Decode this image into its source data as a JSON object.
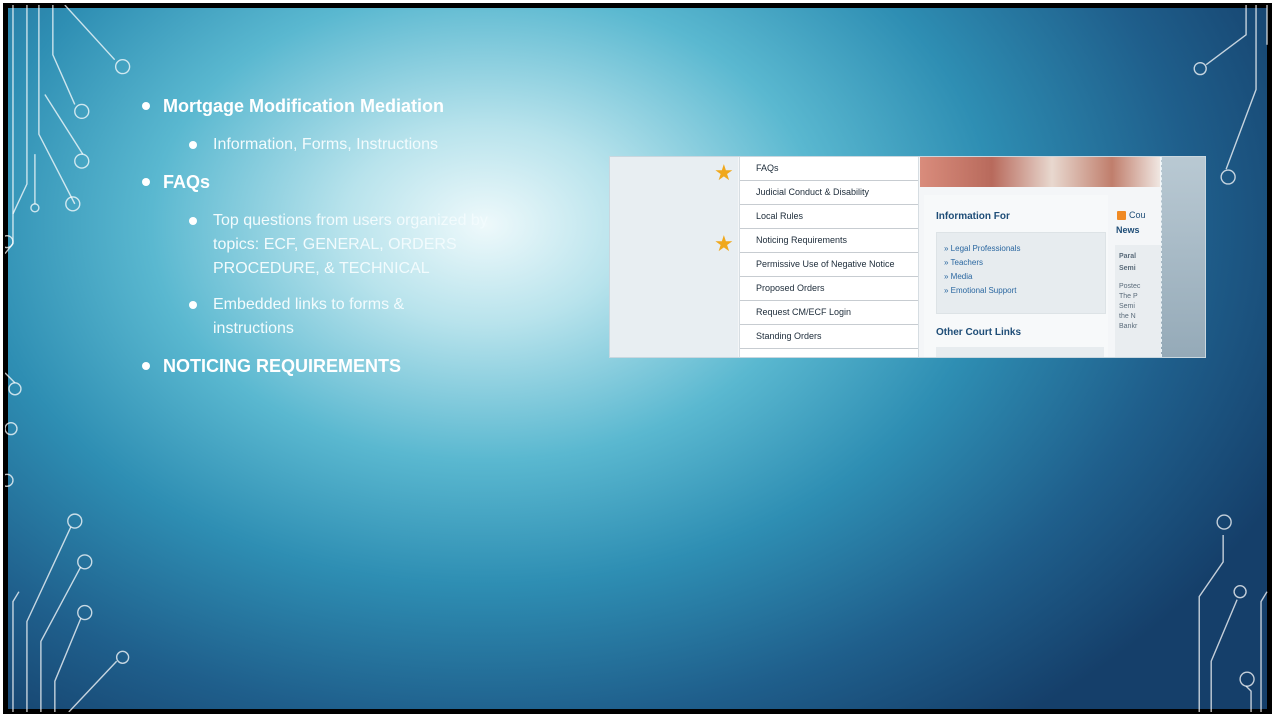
{
  "slide": {
    "bullets": [
      {
        "label": "Mortgage Modification Mediation",
        "sub": [
          "Information, Forms, Instructions"
        ]
      },
      {
        "label": "FAQs",
        "sub": [
          "Top questions from users organized by topics:  ECF, GENERAL, ORDERS PROCEDURE, & TECHNICAL",
          "Embedded links to forms & instructions"
        ]
      },
      {
        "label": "NOTICING REQUIREMENTS",
        "sub": []
      }
    ]
  },
  "screenshot": {
    "menu_items": [
      "FAQs",
      "Judicial Conduct & Disability",
      "Local Rules",
      "Noticing Requirements",
      "Permissive Use of Negative Notice",
      "Proposed Orders",
      "Request CM/ECF Login",
      "Standing Orders"
    ],
    "starred_items": [
      "FAQs",
      "Noticing Requirements"
    ],
    "star_color": "#f0a81c",
    "info_title": "Information For",
    "info_links": [
      "» Legal Professionals",
      "» Teachers",
      "» Media",
      "» Emotional Support"
    ],
    "other_title": "Other Court Links",
    "news": {
      "label_line1": "Cou",
      "label_line2": "News",
      "snippets": [
        "Paral",
        "Semi",
        "Postec",
        "The P",
        "Semi",
        "the N",
        "Bankr"
      ]
    }
  },
  "colors": {
    "bullet_text": "#ffffff",
    "link_blue": "#2a67a0",
    "heading_blue": "#1e4d77"
  }
}
